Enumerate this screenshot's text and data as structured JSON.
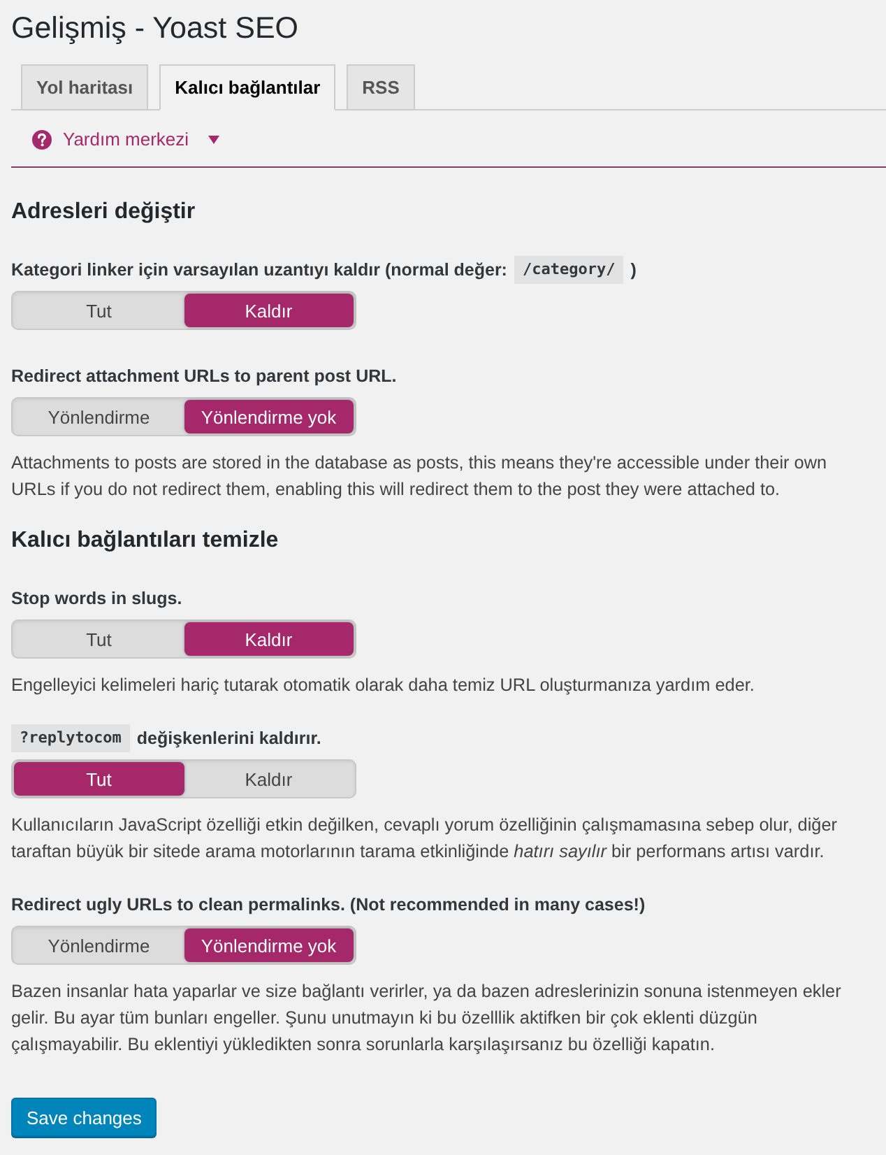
{
  "page": {
    "title": "Gelişmiş - Yoast SEO"
  },
  "tabs": [
    {
      "label": "Yol haritası",
      "selected": false
    },
    {
      "label": "Kalıcı bağlantılar",
      "selected": true
    },
    {
      "label": "RSS",
      "selected": false
    }
  ],
  "help_center": {
    "label": "Yardım merkezi",
    "expanded": false
  },
  "sections": [
    {
      "heading": "Adresleri değiştir",
      "settings": [
        {
          "label": [
            {
              "kind": "text",
              "text": "Kategori linker için varsayılan uzantıyı kaldır (normal değer:"
            },
            {
              "kind": "code",
              "text": "/category/"
            },
            {
              "kind": "text",
              "text": ")"
            }
          ],
          "options": [
            {
              "label": "Tut",
              "selected": false
            },
            {
              "label": "Kaldır",
              "selected": true
            }
          ]
        },
        {
          "label": [
            {
              "kind": "text",
              "text": "Redirect attachment URLs to parent post URL."
            }
          ],
          "options": [
            {
              "label": "Yönlendirme",
              "selected": false
            },
            {
              "label": "Yönlendirme yok",
              "selected": true
            }
          ],
          "description": "Attachments to posts are stored in the database as posts, this means they're accessible under their own URLs if you do not redirect them, enabling this will redirect them to the post they were attached to."
        }
      ]
    },
    {
      "heading": "Kalıcı bağlantıları temizle",
      "settings": [
        {
          "label": [
            {
              "kind": "text",
              "text": "Stop words in slugs."
            }
          ],
          "options": [
            {
              "label": "Tut",
              "selected": false
            },
            {
              "label": "Kaldır",
              "selected": true
            }
          ],
          "description": "Engelleyici kelimeleri hariç tutarak otomatik olarak daha temiz URL oluşturmanıza yardım eder."
        },
        {
          "label": [
            {
              "kind": "code",
              "text": "?replytocom"
            },
            {
              "kind": "text",
              "text": "değişkenlerini kaldırır."
            }
          ],
          "options": [
            {
              "label": "Tut",
              "selected": true
            },
            {
              "label": "Kaldır",
              "selected": false
            }
          ],
          "description": "Kullanıcıların JavaScript özelliği etkin değilken, cevaplı yorum özelliğinin çalışmamasına sebep olur, diğer taraftan büyük bir sitede arama motorlarının tarama etkinliğinde *hatırı sayılır* bir performans artısı vardır."
        },
        {
          "label": [
            {
              "kind": "text",
              "text": "Redirect ugly URLs to clean permalinks. (Not recommended in many cases!)"
            }
          ],
          "options": [
            {
              "label": "Yönlendirme",
              "selected": false
            },
            {
              "label": "Yönlendirme yok",
              "selected": true
            }
          ],
          "description": "Bazen insanlar hata yaparlar ve size bağlantı verirler, ya da bazen adreslerinizin sonuna istenmeyen ekler gelir. Bu ayar tüm bunları engeller. Şunu unutmayın ki bu özelllik aktifken bir çok eklenti düzgün çalışmayabilir. Bu eklentiyi yükledikten sonra sorunlarla karşılaşırsanız bu özelliği kapatın."
        }
      ]
    }
  ],
  "save_button": {
    "label": "Save changes"
  }
}
